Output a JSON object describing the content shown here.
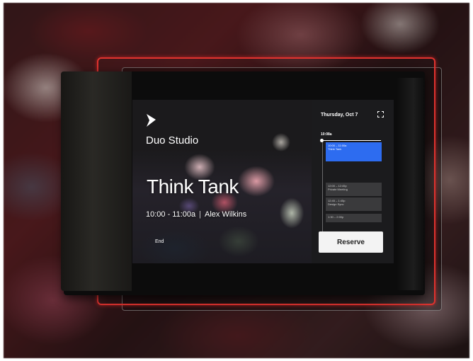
{
  "room": {
    "name": "Duo Studio"
  },
  "meeting": {
    "title": "Think Tank",
    "time": "10:00 - 11:00a",
    "separator": "|",
    "organizer": "Alex Wilkins",
    "end_label": "End"
  },
  "schedule": {
    "date": "Thursday, Oct 7",
    "now_time": "10:08a",
    "events": [
      {
        "time": "10:00 – 11:00a",
        "title": "Think Tank",
        "status": "current"
      },
      {
        "time": "12:00 – 12:45p",
        "title": "Private Meeting",
        "status": "upcoming"
      },
      {
        "time": "12:45 – 1:45p",
        "title": "Design Sync",
        "status": "upcoming"
      },
      {
        "time": "1:30 – 2:00p",
        "title": "",
        "status": "upcoming"
      }
    ],
    "reserve_label": "Reserve"
  },
  "icons": {
    "logo": "chevron-logo-icon",
    "expand": "expand-grid-icon"
  },
  "colors": {
    "accent_blue": "#2d6cf0",
    "frame_red": "#e0332f",
    "panel_dark": "#1b1b1d"
  }
}
